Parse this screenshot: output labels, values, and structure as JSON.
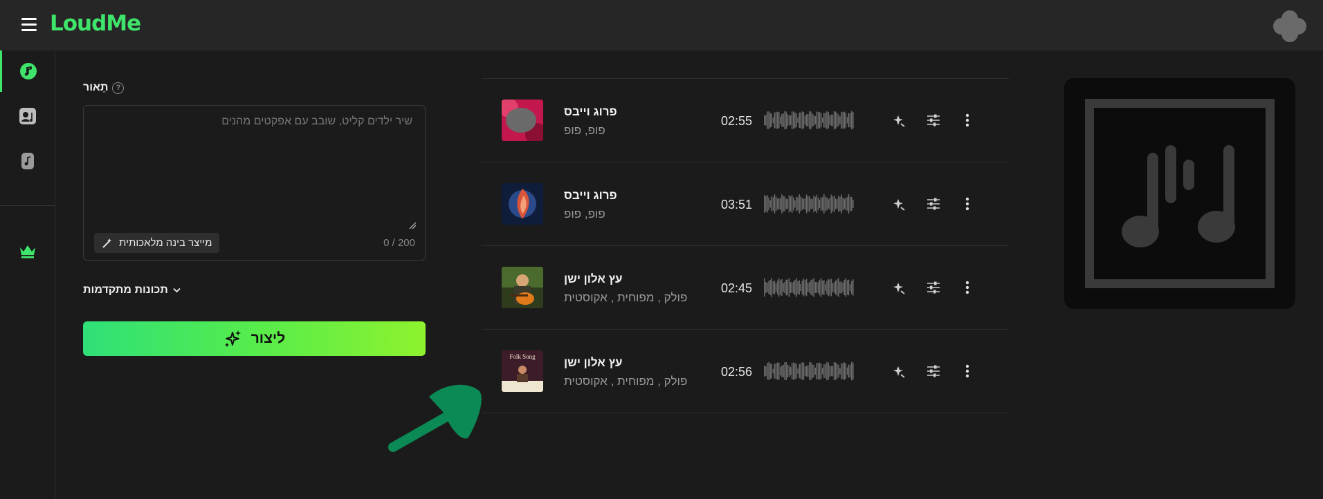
{
  "header": {
    "logo": "LoudMe"
  },
  "sidebar": {
    "items": [
      {
        "name": "music-note-icon"
      },
      {
        "name": "cover-song-icon"
      },
      {
        "name": "instrumental-icon"
      },
      {
        "name": "crown-icon"
      }
    ]
  },
  "form": {
    "description_label": "תֵאור",
    "description_value": "",
    "description_placeholder": "שיר ילדים קליט, שובב עם אפקטים מהנים",
    "ai_button_label": "מייצר בינה מלאכותית",
    "counter": "0 / 200",
    "advanced_label": "תכונות מתקדמות",
    "create_label": "ליצור"
  },
  "songs": [
    {
      "title": "פרוג וייבס",
      "tags": "פופ, פופ",
      "duration": "02:55",
      "cover": "pink-smoke"
    },
    {
      "title": "פרוג וייבס",
      "tags": "פופ, פופ",
      "duration": "03:51",
      "cover": "blue-fire"
    },
    {
      "title": "עץ אלון ישן",
      "tags": "פולק , מפוחית , אקוסטית",
      "duration": "02:45",
      "cover": "guitarist"
    },
    {
      "title": "עץ אלון ישן",
      "tags": "פולק , מפוחית , אקוסטית",
      "duration": "02:56",
      "cover": "folk-song",
      "cover_text": "Folk Song"
    }
  ],
  "colors": {
    "accent": "#3ee56a",
    "annotation_arrow": "#0b8a55"
  }
}
